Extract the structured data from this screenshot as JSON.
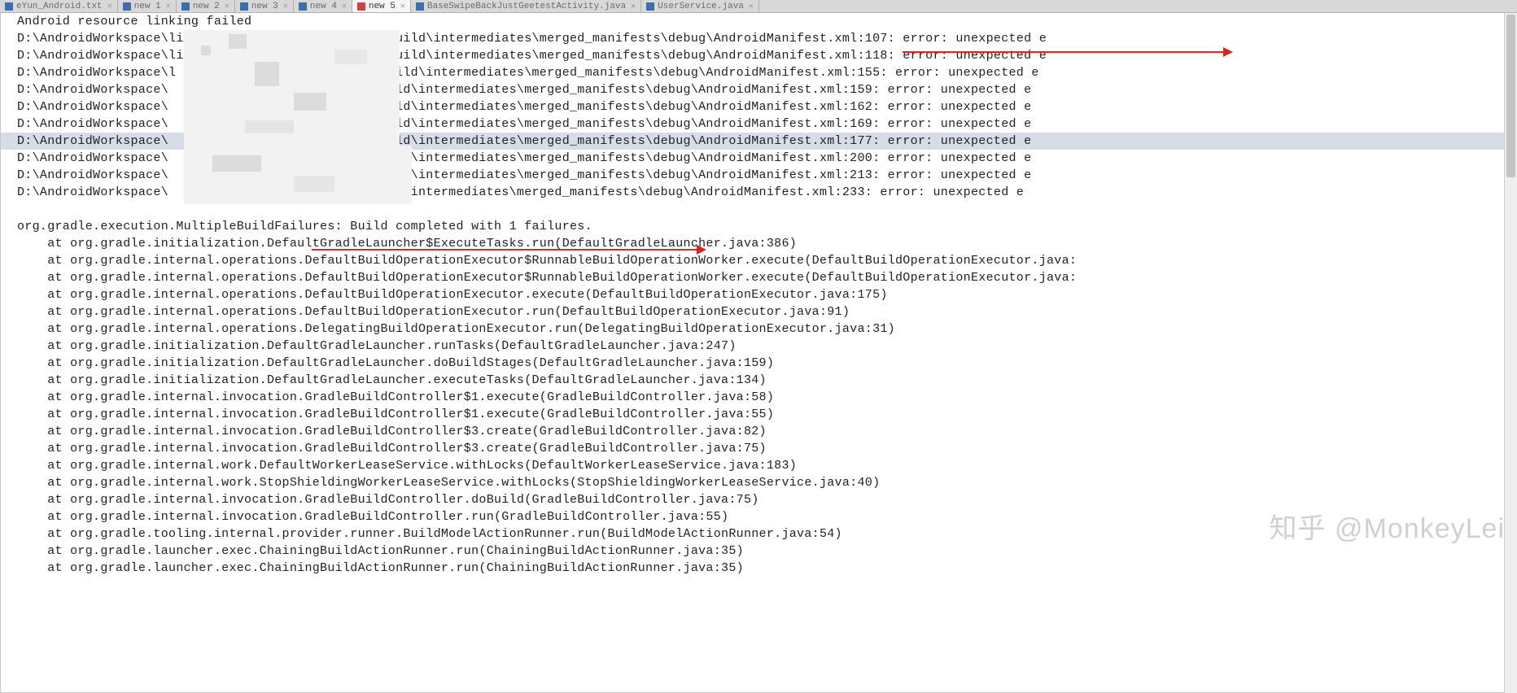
{
  "tabs": [
    {
      "label": "eYun_Android.txt",
      "kind": "blue",
      "active": false
    },
    {
      "label": "new 1",
      "kind": "blue",
      "active": false
    },
    {
      "label": "new 2",
      "kind": "blue",
      "active": false
    },
    {
      "label": "new 3",
      "kind": "blue",
      "active": false
    },
    {
      "label": "new 4",
      "kind": "blue",
      "active": false
    },
    {
      "label": "new 5",
      "kind": "red",
      "active": true
    },
    {
      "label": "BaseSwipeBackJustGeetestActivity.java",
      "kind": "blue",
      "active": false
    },
    {
      "label": "UserService.java",
      "kind": "blue",
      "active": false
    }
  ],
  "editor": {
    "lines": [
      {
        "text": "Android resource linking failed",
        "hl": false
      },
      {
        "text": "D:\\AndroidWorkspace\\li   n\\          oid2019\\app\\build\\intermediates\\merged_manifests\\debug\\AndroidManifest.xml:107: error: unexpected e",
        "hl": false
      },
      {
        "text": "D:\\AndroidWorkspace\\li                id2019\\app\\build\\intermediates\\merged_manifests\\debug\\AndroidManifest.xml:118: error: unexpected e",
        "hl": false
      },
      {
        "text": "D:\\AndroidWorkspace\\l                 d2019\\app\\build\\intermediates\\merged_manifests\\debug\\AndroidManifest.xml:155: error: unexpected e",
        "hl": false
      },
      {
        "text": "D:\\AndroidWorkspace\\             dr   2019\\app\\build\\intermediates\\merged_manifests\\debug\\AndroidManifest.xml:159: error: unexpected e",
        "hl": false
      },
      {
        "text": "D:\\AndroidWorkspace\\                  2019\\app\\build\\intermediates\\merged_manifests\\debug\\AndroidManifest.xml:162: error: unexpected e",
        "hl": false
      },
      {
        "text": "D:\\AndroidWorkspace\\     li           2019\\app\\build\\intermediates\\merged_manifests\\debug\\AndroidManifest.xml:169: error: unexpected e",
        "hl": false
      },
      {
        "text": "D:\\AndroidWorkspace\\             i    2019\\app\\build\\intermediates\\merged_manifests\\debug\\AndroidManifest.xml:177: error: unexpected e",
        "hl": true
      },
      {
        "text": "D:\\AndroidWorkspace\\            dr    2019\\app\\build\\intermediates\\merged_manifests\\debug\\AndroidManifest.xml:200: error: unexpected e",
        "hl": false
      },
      {
        "text": "D:\\AndroidWorkspace\\             d    2019\\app\\build\\intermediates\\merged_manifests\\debug\\AndroidManifest.xml:213: error: unexpected e",
        "hl": false
      },
      {
        "text": "D:\\AndroidWorkspace\\  .yun      droid2019\\app\\build\\intermediates\\merged_manifests\\debug\\AndroidManifest.xml:233: error: unexpected e",
        "hl": false
      },
      {
        "text": "",
        "hl": false
      },
      {
        "text": "org.gradle.execution.MultipleBuildFailures: Build completed with 1 failures.",
        "hl": false
      },
      {
        "text": "    at org.gradle.initialization.DefaultGradleLauncher$ExecuteTasks.run(DefaultGradleLauncher.java:386)",
        "hl": false
      },
      {
        "text": "    at org.gradle.internal.operations.DefaultBuildOperationExecutor$RunnableBuildOperationWorker.execute(DefaultBuildOperationExecutor.java:",
        "hl": false
      },
      {
        "text": "    at org.gradle.internal.operations.DefaultBuildOperationExecutor$RunnableBuildOperationWorker.execute(DefaultBuildOperationExecutor.java:",
        "hl": false
      },
      {
        "text": "    at org.gradle.internal.operations.DefaultBuildOperationExecutor.execute(DefaultBuildOperationExecutor.java:175)",
        "hl": false
      },
      {
        "text": "    at org.gradle.internal.operations.DefaultBuildOperationExecutor.run(DefaultBuildOperationExecutor.java:91)",
        "hl": false
      },
      {
        "text": "    at org.gradle.internal.operations.DelegatingBuildOperationExecutor.run(DelegatingBuildOperationExecutor.java:31)",
        "hl": false
      },
      {
        "text": "    at org.gradle.initialization.DefaultGradleLauncher.runTasks(DefaultGradleLauncher.java:247)",
        "hl": false
      },
      {
        "text": "    at org.gradle.initialization.DefaultGradleLauncher.doBuildStages(DefaultGradleLauncher.java:159)",
        "hl": false
      },
      {
        "text": "    at org.gradle.initialization.DefaultGradleLauncher.executeTasks(DefaultGradleLauncher.java:134)",
        "hl": false
      },
      {
        "text": "    at org.gradle.internal.invocation.GradleBuildController$1.execute(GradleBuildController.java:58)",
        "hl": false
      },
      {
        "text": "    at org.gradle.internal.invocation.GradleBuildController$1.execute(GradleBuildController.java:55)",
        "hl": false
      },
      {
        "text": "    at org.gradle.internal.invocation.GradleBuildController$3.create(GradleBuildController.java:82)",
        "hl": false
      },
      {
        "text": "    at org.gradle.internal.invocation.GradleBuildController$3.create(GradleBuildController.java:75)",
        "hl": false
      },
      {
        "text": "    at org.gradle.internal.work.DefaultWorkerLeaseService.withLocks(DefaultWorkerLeaseService.java:183)",
        "hl": false
      },
      {
        "text": "    at org.gradle.internal.work.StopShieldingWorkerLeaseService.withLocks(StopShieldingWorkerLeaseService.java:40)",
        "hl": false
      },
      {
        "text": "    at org.gradle.internal.invocation.GradleBuildController.doBuild(GradleBuildController.java:75)",
        "hl": false
      },
      {
        "text": "    at org.gradle.internal.invocation.GradleBuildController.run(GradleBuildController.java:55)",
        "hl": false
      },
      {
        "text": "    at org.gradle.tooling.internal.provider.runner.BuildModelActionRunner.run(BuildModelActionRunner.java:54)",
        "hl": false
      },
      {
        "text": "    at org.gradle.launcher.exec.ChainingBuildActionRunner.run(ChainingBuildActionRunner.java:35)",
        "hl": false
      },
      {
        "text": "    at org.gradle.launcher.exec.ChainingBuildActionRunner.run(ChainingBuildActionRunner.java:35)",
        "hl": false
      }
    ]
  },
  "watermark": "知乎 @MonkeyLei"
}
